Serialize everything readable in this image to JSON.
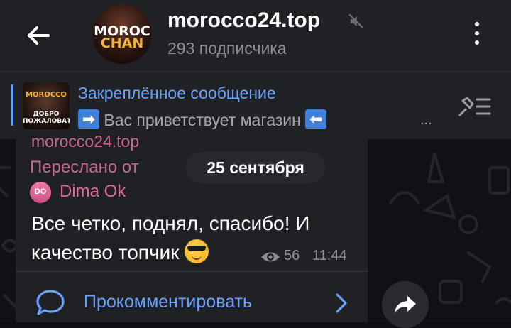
{
  "header": {
    "channel_name": "morocco24.top",
    "subscribers": "293 подписчика",
    "avatar_text_line1": "MOROC",
    "avatar_text_line2": "CHAN"
  },
  "pinned": {
    "title": "Закреплённое сообщение",
    "text_before": "Вас приветствует магазин",
    "arrow_right": "➡",
    "arrow_left": "⬅",
    "ellipsis": "...",
    "thumb_line1": "MOROCCO",
    "thumb_line2": "ДОБРО ПОЖАЛОВАТЬ"
  },
  "message": {
    "forwarded_channel": "morocco24.top",
    "forwarded_label": "Переслано от",
    "author_initials": "DO",
    "author_name": "Dima Ok",
    "text_line1": "Все четко, поднял, спасибо! И",
    "text_line2": "качество топчик",
    "views": "56",
    "time": "11:44",
    "comment_label": "Прокомментировать"
  },
  "date_pill": "25 сентября",
  "colors": {
    "accent": "#6aa1ff",
    "forward_pink": "#c56a8c",
    "background": "#0e0f12",
    "bubble": "#1f2023"
  }
}
